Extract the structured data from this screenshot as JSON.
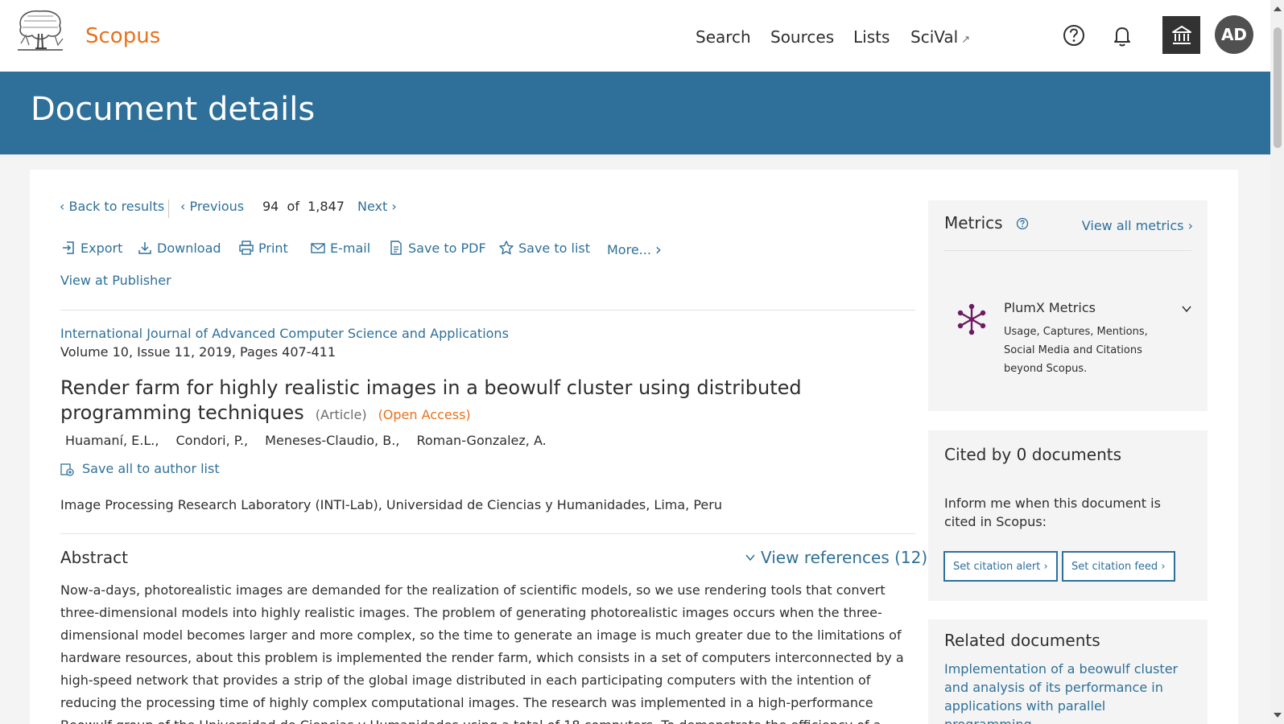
{
  "header": {
    "brand": "Scopus",
    "nav": [
      "Search",
      "Sources",
      "Lists",
      "SciVal"
    ],
    "scival_ext": "↗",
    "avatar_initials": "AD"
  },
  "banner": {
    "title": "Document details"
  },
  "pager": {
    "back": "Back to results",
    "previous": "Previous",
    "current": "94",
    "of": "of",
    "total": "1,847",
    "next": "Next"
  },
  "toolbar": {
    "export": "Export",
    "download": "Download",
    "print": "Print",
    "email": "E-mail",
    "save_pdf": "Save to PDF",
    "save_list": "Save to list",
    "more": "More...",
    "view_publisher": "View at Publisher"
  },
  "document": {
    "journal": "International Journal of Advanced Computer Science and Applications",
    "volume": "Volume 10, Issue 11, 2019, Pages 407-411",
    "title": "Render farm for highly realistic images in a beowulf cluster using distributed programming techniques",
    "type": "(Article)",
    "access": "(Open Access)",
    "authors": [
      "Huamaní, E.L.,",
      "Condori, P.,",
      "Meneses-Claudio, B.,",
      "Roman-Gonzalez, A."
    ],
    "save_authors": "Save all to author list",
    "affiliation": "Image Processing Research Laboratory (INTI-Lab), Universidad de Ciencias y Humanidades, Lima, Peru",
    "abstract_heading": "Abstract",
    "view_references": "View references (12)",
    "abstract": "Now-a-days, photorealistic images are demanded for the realization of scientific models, so we use rendering tools that convert three-dimensional models into highly realistic images. The problem of generating photorealistic images occurs when the three-dimensional model becomes larger and more complex, so the time to generate an image is much greater due to the limitations of hardware resources, about this problem is implemented the render farm, which consists in a set of computers interconnected by a high-speed network that provides a strip of the global image distributed in each participating computers with the intention of reducing the processing time of highly complex computational images. The research was implemented in a high-performance Beowulf group of the Universidad de Ciencias y Humanidades using a total of 18 computers. To demonstrate the efficiency of a rendering farm implementation and ability to test"
  },
  "metrics": {
    "heading": "Metrics",
    "view_all": "View all metrics",
    "plumx_title": "PlumX Metrics",
    "plumx_desc": "Usage, Captures, Mentions, Social Media and Citations beyond Scopus."
  },
  "cited": {
    "heading": "Cited by 0 documents",
    "desc": "Inform me when this document is cited in Scopus:",
    "alert_btn": "Set citation alert",
    "feed_btn": "Set citation feed"
  },
  "related": {
    "heading": "Related documents",
    "first": "Implementation of a beowulf cluster and analysis of its performance in applications with parallel programming"
  },
  "colors": {
    "brand_orange": "#e9711c",
    "banner_blue": "#2e7099",
    "link_blue": "#2e7099"
  }
}
